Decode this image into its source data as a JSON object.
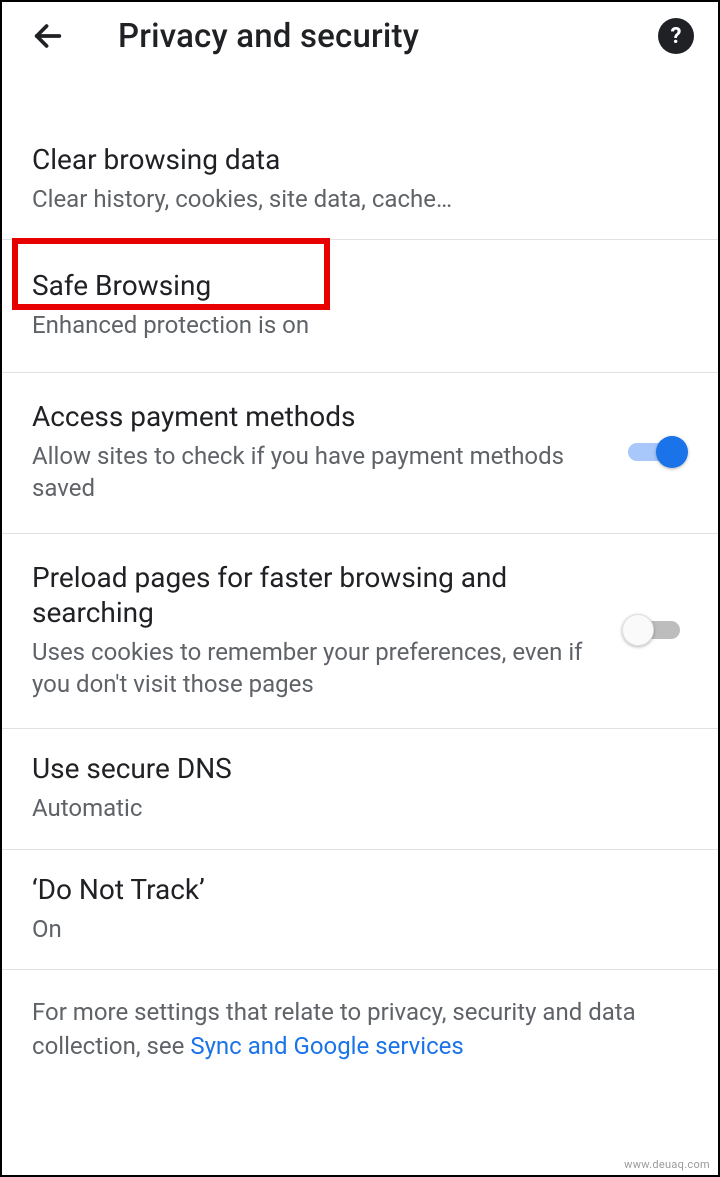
{
  "header": {
    "title": "Privacy and security"
  },
  "items": {
    "clear": {
      "title": "Clear browsing data",
      "subtitle": "Clear history, cookies, site data, cache…"
    },
    "safe": {
      "title": "Safe Browsing",
      "subtitle": "Enhanced protection is on"
    },
    "payment": {
      "title": "Access payment methods",
      "subtitle": "Allow sites to check if you have payment methods saved",
      "enabled": true
    },
    "preload": {
      "title": "Preload pages for faster browsing and searching",
      "subtitle": "Uses cookies to remember your preferences, even if you don't visit those pages",
      "enabled": false
    },
    "dns": {
      "title": "Use secure DNS",
      "subtitle": "Automatic"
    },
    "dnt": {
      "title": "‘Do Not Track’",
      "subtitle": "On"
    }
  },
  "footer": {
    "prefix": "For more settings that relate to privacy, security and data collection, see ",
    "link": "Sync and Google services"
  },
  "watermark": "www.deuaq.com"
}
